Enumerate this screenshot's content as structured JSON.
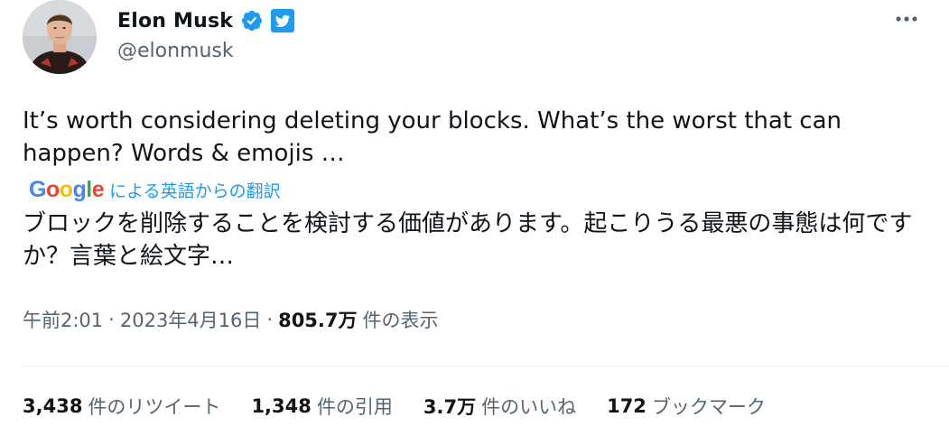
{
  "author": {
    "name": "Elon Musk",
    "handle": "@elonmusk",
    "avatar_icon": "avatar-photo",
    "verified_icon": "verified-badge-icon",
    "platform_icon": "twitter-bird-icon"
  },
  "tweet": {
    "text": "It’s worth considering deleting your blocks. What’s the worst that can happen? Words & emojis …",
    "translation": {
      "provider_logo": "Google",
      "link_label": "による英語からの翻訳",
      "text": "ブロックを削除することを検討する価値があります。起こりうる最悪の事態は何ですか？言葉と絵文字…"
    }
  },
  "meta": {
    "time": "午前2:01",
    "separator": "·",
    "date": "2023年4月16日",
    "views_count": "805.7万",
    "views_label": "件の表示"
  },
  "stats": [
    {
      "count": "3,438",
      "label": "件のリツイート"
    },
    {
      "count": "1,348",
      "label": "件の引用"
    },
    {
      "count": "3.7万",
      "label": "件のいいね"
    },
    {
      "count": "172",
      "label": "ブックマーク"
    }
  ],
  "colors": {
    "accent": "#1d9bf0",
    "text": "#0f1419",
    "secondary": "#536471",
    "google_blue": "#4285F4",
    "google_red": "#EA4335",
    "google_yellow": "#FBBC05",
    "google_green": "#34A853"
  }
}
